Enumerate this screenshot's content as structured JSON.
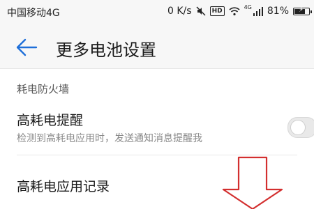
{
  "status_bar": {
    "carrier": "中国移动4G",
    "speed": "0 K/s",
    "hd_badge": "HD",
    "network_type": "4G",
    "battery_percent": "81%",
    "battery_level": 0.81
  },
  "toolbar": {
    "title": "更多电池设置",
    "back_icon": "back-arrow-icon"
  },
  "section": {
    "header": "耗电防火墙"
  },
  "items": [
    {
      "title": "高耗电提醒",
      "subtitle": "检测到高耗电应用时，发送通知消息提醒我",
      "toggle_on": false
    },
    {
      "title": "高耗电应用记录"
    }
  ],
  "annotation": {
    "icon": "red-down-arrow-icon",
    "color": "#d32f2f"
  },
  "colors": {
    "accent": "#1e6fd9",
    "background": "#ffffff",
    "bar_background": "#f7f7f7"
  }
}
